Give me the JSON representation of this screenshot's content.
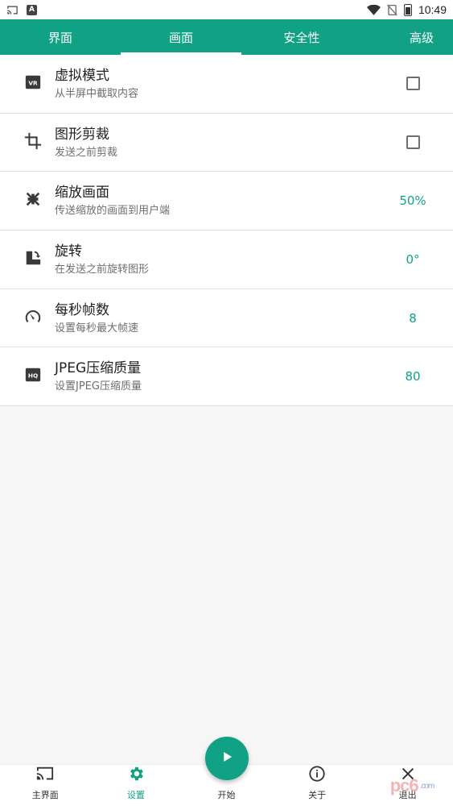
{
  "status_bar": {
    "time": "10:49",
    "left_icons": [
      "cast-icon",
      "a-letter-icon"
    ],
    "right_icons": [
      "wifi-icon",
      "signal-off-icon",
      "battery-charging-icon"
    ],
    "letter": "A"
  },
  "tabs": [
    {
      "label": "界面",
      "active": false
    },
    {
      "label": "画面",
      "active": true
    },
    {
      "label": "安全性",
      "active": false
    },
    {
      "label": "高级",
      "active": false
    }
  ],
  "settings": [
    {
      "icon": "vr-icon",
      "title": "虚拟模式",
      "subtitle": "从半屏中截取内容",
      "control": "checkbox",
      "checked": false
    },
    {
      "icon": "crop-icon",
      "title": "图形剪裁",
      "subtitle": "发送之前剪裁",
      "control": "checkbox",
      "checked": false
    },
    {
      "icon": "shrink-icon",
      "title": "缩放画面",
      "subtitle": "传送缩放的画面到用户端",
      "control": "value",
      "value": "50%"
    },
    {
      "icon": "rotate-icon",
      "title": "旋转",
      "subtitle": "在发送之前旋转图形",
      "control": "value",
      "value": "0°"
    },
    {
      "icon": "speedometer-icon",
      "title": "每秒帧数",
      "subtitle": "设置每秒最大帧速",
      "control": "value",
      "value": "8"
    },
    {
      "icon": "hq-icon",
      "title": "JPEG压缩质量",
      "subtitle": "设置JPEG压缩质量",
      "control": "value",
      "value": "80"
    }
  ],
  "bottom_nav": [
    {
      "icon": "cast-screen-icon",
      "label": "主界面",
      "active": false
    },
    {
      "icon": "gear-icon",
      "label": "设置",
      "active": true
    },
    {
      "icon": "play-icon",
      "label": "开始",
      "active": false
    },
    {
      "icon": "info-icon",
      "label": "关于",
      "active": false
    },
    {
      "icon": "close-icon",
      "label": "退出",
      "active": false
    }
  ],
  "watermark": {
    "text": "pc6",
    "suffix": ".com"
  },
  "colors": {
    "accent": "#11a286",
    "background": "#f6f6f6"
  }
}
